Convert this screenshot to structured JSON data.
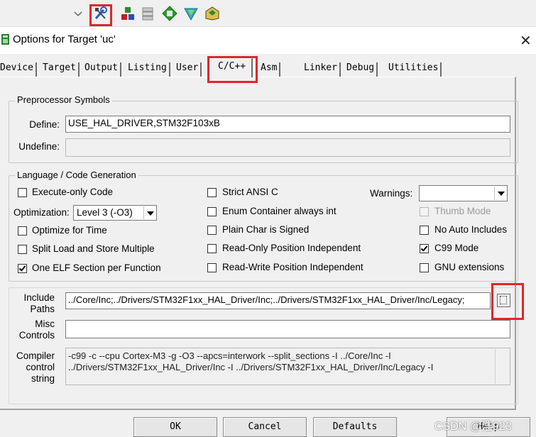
{
  "toolbar": {
    "icons": [
      "dropdown-chevron-icon",
      "target-options-icon",
      "manage-project-items-icon",
      "select-packs-icon",
      "pack-installer-icon",
      "manage-run-time-icon",
      "components-icon"
    ]
  },
  "dialog": {
    "title": "Options for Target 'uc'",
    "close": "✕"
  },
  "tabs": [
    {
      "label": "Device"
    },
    {
      "label": "Target"
    },
    {
      "label": "Output"
    },
    {
      "label": "Listing"
    },
    {
      "label": "User"
    },
    {
      "label": "C/C++"
    },
    {
      "label": "Asm"
    },
    {
      "label": "Linker"
    },
    {
      "label": "Debug"
    },
    {
      "label": "Utilities"
    }
  ],
  "preprocessor": {
    "title": "Preprocessor Symbols",
    "define_label": "Define:",
    "define_value": "USE_HAL_DRIVER,STM32F103xB",
    "undefine_label": "Undefine:",
    "undefine_value": ""
  },
  "language": {
    "title": "Language / Code Generation",
    "execute_only": {
      "label": "Execute-only Code",
      "checked": false
    },
    "optimization_label": "Optimization:",
    "optimization_value": "Level 3 (-O3)",
    "optimize_time": {
      "label": "Optimize for Time",
      "checked": false
    },
    "split_load": {
      "label": "Split Load and Store Multiple",
      "checked": false
    },
    "one_elf": {
      "label": "One ELF Section per Function",
      "checked": true
    },
    "strict_ansi": {
      "label": "Strict ANSI C",
      "checked": false
    },
    "enum_container": {
      "label": "Enum Container always int",
      "checked": false
    },
    "plain_char": {
      "label": "Plain Char is Signed",
      "checked": false
    },
    "ropi": {
      "label": "Read-Only Position Independent",
      "checked": false
    },
    "rwpi": {
      "label": "Read-Write Position Independent",
      "checked": false
    },
    "warnings_label": "Warnings:",
    "warnings_value": "",
    "thumb_mode": {
      "label": "Thumb Mode",
      "checked": false,
      "disabled": true
    },
    "no_auto_includes": {
      "label": "No Auto Includes",
      "checked": false
    },
    "c99_mode": {
      "label": "C99 Mode",
      "checked": true
    },
    "gnu_extensions": {
      "label": "GNU extensions",
      "checked": false
    }
  },
  "include_paths": {
    "label_line1": "Include",
    "label_line2": "Paths",
    "value": "../Core/Inc;../Drivers/STM32F1xx_HAL_Driver/Inc;../Drivers/STM32F1xx_HAL_Driver/Inc/Legacy;"
  },
  "misc_controls": {
    "label_line1": "Misc",
    "label_line2": "Controls",
    "value": ""
  },
  "compiler_string": {
    "label_line1": "Compiler",
    "label_line2": "control",
    "label_line3": "string",
    "value": "-c99 -c --cpu Cortex-M3 -g -O3 --apcs=interwork --split_sections -I ../Core/Inc -I\n../Drivers/STM32F1xx_HAL_Driver/Inc -I ../Drivers/STM32F1xx_HAL_Driver/Inc/Legacy -I"
  },
  "buttons": {
    "ok": "OK",
    "cancel": "Cancel",
    "defaults": "Defaults",
    "help": "Help"
  },
  "watermark": "CSDN @浩923",
  "colors": {
    "highlight": "#e0262b",
    "dialog_bg": "#f0f0f0"
  }
}
